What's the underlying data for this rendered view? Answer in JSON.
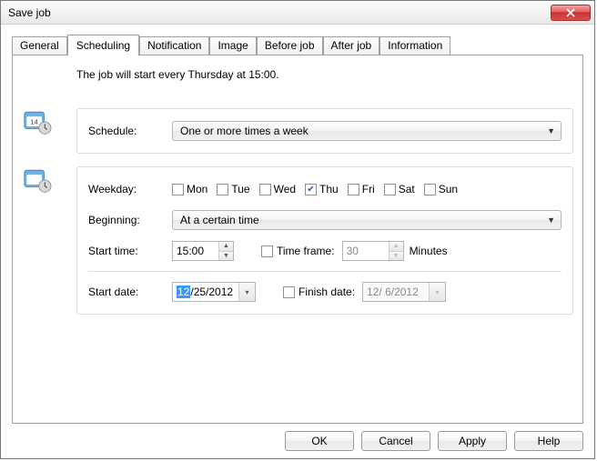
{
  "window": {
    "title": "Save job"
  },
  "tabs": [
    {
      "label": "General"
    },
    {
      "label": "Scheduling"
    },
    {
      "label": "Notification"
    },
    {
      "label": "Image"
    },
    {
      "label": "Before job"
    },
    {
      "label": "After job"
    },
    {
      "label": "Information"
    }
  ],
  "summary": "The job will start every Thursday at 15:00.",
  "labels": {
    "schedule": "Schedule:",
    "weekday": "Weekday:",
    "beginning": "Beginning:",
    "start_time": "Start time:",
    "time_frame": "Time frame:",
    "minutes": "Minutes",
    "start_date": "Start date:",
    "finish_date": "Finish date:"
  },
  "schedule": {
    "value": "One or more times a week"
  },
  "weekdays": {
    "mon": {
      "label": "Mon",
      "checked": false
    },
    "tue": {
      "label": "Tue",
      "checked": false
    },
    "wed": {
      "label": "Wed",
      "checked": false
    },
    "thu": {
      "label": "Thu",
      "checked": true
    },
    "fri": {
      "label": "Fri",
      "checked": false
    },
    "sat": {
      "label": "Sat",
      "checked": false
    },
    "sun": {
      "label": "Sun",
      "checked": false
    }
  },
  "beginning": {
    "value": "At a certain time"
  },
  "start_time": "15:00",
  "time_frame": {
    "checked": false,
    "value": "30"
  },
  "start_date": {
    "sel": "12",
    "rest": "/25/2012"
  },
  "finish_date": {
    "checked": false,
    "value": "12/ 6/2012"
  },
  "buttons": {
    "ok": "OK",
    "cancel": "Cancel",
    "apply": "Apply",
    "help": "Help"
  }
}
